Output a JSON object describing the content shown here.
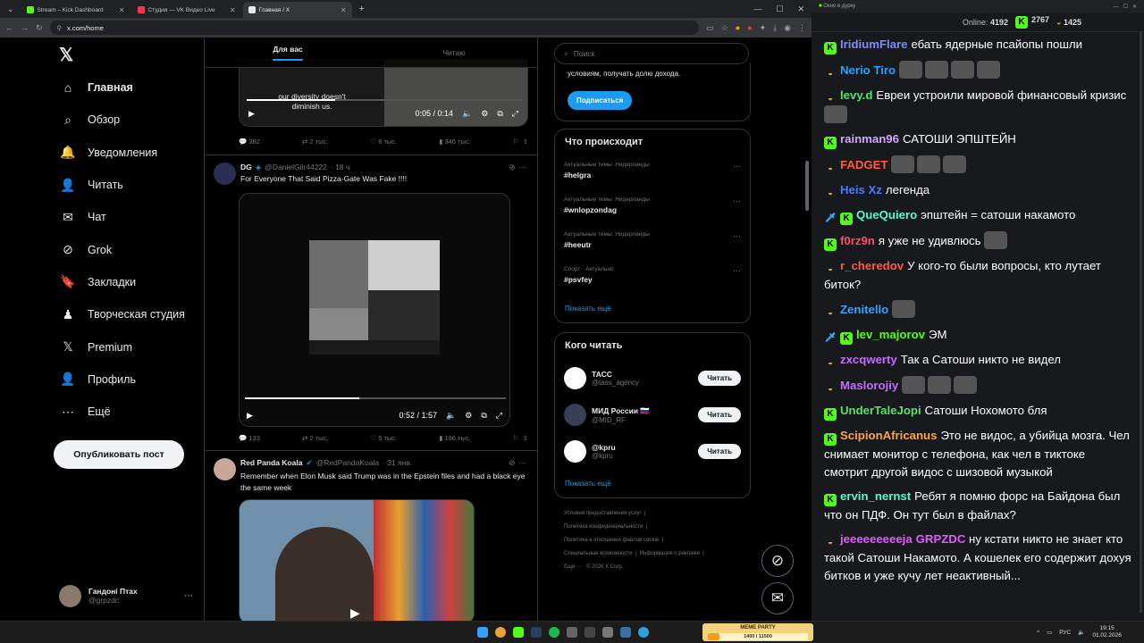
{
  "browser": {
    "tabs": [
      {
        "title": "Stream – Kick Dashboard",
        "color": "#53fc18"
      },
      {
        "title": "Студия — VK Видео Live",
        "color": "#ff3347"
      },
      {
        "title": "Главная / X",
        "color": "#e7e9ea"
      }
    ],
    "url": "x.com/home"
  },
  "x": {
    "logo": "𝕏",
    "nav": [
      {
        "label": "Главная",
        "icon": "home-icon",
        "glyph": "⌂"
      },
      {
        "label": "Обзор",
        "icon": "search-icon",
        "glyph": "⌕"
      },
      {
        "label": "Уведомления",
        "icon": "bell-icon",
        "glyph": "🔔"
      },
      {
        "label": "Читать",
        "icon": "follow-icon",
        "glyph": "👤"
      },
      {
        "label": "Чат",
        "icon": "mail-icon",
        "glyph": "✉"
      },
      {
        "label": "Grok",
        "icon": "grok-icon",
        "glyph": "⊘"
      },
      {
        "label": "Закладки",
        "icon": "bookmark-icon",
        "glyph": "🔖"
      },
      {
        "label": "Творческая студия",
        "icon": "studio-icon",
        "glyph": "♟"
      },
      {
        "label": "Premium",
        "icon": "premium-icon",
        "glyph": "𝕏"
      },
      {
        "label": "Профиль",
        "icon": "profile-icon",
        "glyph": "👤"
      },
      {
        "label": "Ещё",
        "icon": "more-icon",
        "glyph": "⋯"
      }
    ],
    "post_button": "Опубликовать пост",
    "account": {
      "name": "Гандоні Птах",
      "handle": "@grpzdc"
    },
    "feed_tabs": [
      "Для вас",
      "Читаю"
    ],
    "post0": {
      "caption_line1": "our diversity doesn't",
      "caption_line2": "diminish us.",
      "time": "0:05 / 0:14",
      "stats": [
        "382",
        "2 тыс.",
        "6 тыс.",
        "346 тыс."
      ]
    },
    "post1": {
      "name": "DG",
      "handle": "@DanielGilr44222",
      "ago": "· 18 ч",
      "text": "For Everyone That Said Pizza-Gate Was Fake !!!!",
      "time": "0:52 / 1:57",
      "stats": [
        "133",
        "2 тыс.",
        "5 тыс.",
        "196 тыс."
      ]
    },
    "post2": {
      "name": "Red Panda Koala",
      "handle": "@RedPandaKoala",
      "ago": "· 31 янв.",
      "text": "Remember when Elon Musk said Trump was in the Epstein files and had a black eye the same week"
    },
    "search_placeholder": "Поиск",
    "premium": {
      "text": "условиям, получать долю дохода.",
      "button": "Подписаться"
    },
    "trends_title": "Что происходит",
    "trends": [
      {
        "context": "Актуальные темы: Нидерланды",
        "tag": "#helgra"
      },
      {
        "context": "Актуальные темы: Нидерланды",
        "tag": "#wnlopzondag"
      },
      {
        "context": "Актуальные темы: Нидерланды",
        "tag": "#heeutr"
      },
      {
        "context": "Спорт · Актуально",
        "tag": "#psvfey"
      }
    ],
    "show_more": "Показать ещё",
    "who_title": "Кого читать",
    "who": [
      {
        "name": "ТАСС",
        "handle": "@tass_agency",
        "btn": "Читать",
        "color": "#ffffff"
      },
      {
        "name": "МИД России 🇷🇺",
        "handle": "@MID_RF",
        "btn": "Читать",
        "color": "#3a3f55"
      },
      {
        "name": "@kpru",
        "handle": "@kpru",
        "btn": "Читать",
        "color": "#ffffff"
      }
    ],
    "footer": [
      "Условия предоставления услуг",
      "Политика конфиденциальности",
      "Политика в отношении файлов cookie",
      "Специальные возможности",
      "Информация о рекламе",
      "Ещё ···",
      "© 2026 X Corp."
    ]
  },
  "chat": {
    "window_title": "Окно в дурку",
    "online_label": "Online:",
    "online": "4192",
    "kick_count": "2767",
    "other_count": "1425",
    "messages": [
      {
        "badges": [
          "kick"
        ],
        "user": "IridiumFlare",
        "color": "#7b8cff",
        "text": "ебать ядерные псайопы пошли",
        "emotes": 0
      },
      {
        "badges": [
          "sub"
        ],
        "user": "Nerio Tiro",
        "color": "#1fa3ff",
        "text": "",
        "emotes": 4
      },
      {
        "badges": [
          "sub"
        ],
        "user": "levy.d",
        "color": "#58e06a",
        "text": "Евреи устроили мировой финансовый кризис",
        "emotes": 1
      },
      {
        "badges": [
          "kick"
        ],
        "user": "rainman96",
        "color": "#d4a4ff",
        "text": "САТОШИ ЭПШТЕЙН",
        "emotes": 0
      },
      {
        "badges": [
          "sub"
        ],
        "user": "FADGET",
        "color": "#ff5a3c",
        "text": "",
        "emotes": 3
      },
      {
        "badges": [
          "sub"
        ],
        "user": "Heis Xz",
        "color": "#4a7cff",
        "text": "легенда",
        "emotes": 0
      },
      {
        "badges": [
          "sword",
          "kick"
        ],
        "user": "QueQuiero",
        "color": "#53fcc4",
        "text": "эпштейн = сатоши накамото",
        "emotes": 0
      },
      {
        "badges": [
          "kick"
        ],
        "user": "f0rz9n",
        "color": "#ff4d6a",
        "text": "я уже не удивлюсь",
        "emotes": 1
      },
      {
        "badges": [
          "sub"
        ],
        "user": "r_cheredov",
        "color": "#ff5a3c",
        "text": "У кого-то были вопросы, кто лутает биток?",
        "emotes": 0
      },
      {
        "badges": [
          "sub"
        ],
        "user": "Zenitello",
        "color": "#3aa0ff",
        "text": "",
        "emotes": 1
      },
      {
        "badges": [
          "sword",
          "kick"
        ],
        "user": "lev_majorov",
        "color": "#53fc18",
        "text": "ЭМ",
        "emotes": 0
      },
      {
        "badges": [
          "sub"
        ],
        "user": "zxcqwerty",
        "color": "#c46bff",
        "text": "Так а Сатоши никто не видел",
        "emotes": 0
      },
      {
        "badges": [
          "sub"
        ],
        "user": "Maslorojiy",
        "color": "#c46bff",
        "text": "",
        "emotes": 3
      },
      {
        "badges": [
          "kick"
        ],
        "user": "UnderTaleJopi",
        "color": "#58e06a",
        "text": "Сатоши Нохомото бля",
        "emotes": 0
      },
      {
        "badges": [
          "kick"
        ],
        "user": "ScipionAfricanus",
        "color": "#ffa53a",
        "text": "Это не видос, а убийца мозга. Чел снимает монитор с телефона, как чел в тиктоке смотрит другой видос с шизовой музыкой",
        "emotes": 0
      },
      {
        "badges": [
          "kick"
        ],
        "user": "ervin_nernst",
        "color": "#53fcc4",
        "text": "Ребят я помню форс на Байдона был что он ПДФ. Он тут был в файлах?",
        "emotes": 0
      },
      {
        "badges": [
          "sub"
        ],
        "user": "jeeeeeeeeeja",
        "color": "#e05cff",
        "mention": "GRPZDC",
        "text": "ну кстати никто не знает кто такой Сатоши Накамото. А кошелек его содержит дохуя битков и уже кучу лет неактивный...",
        "emotes": 0
      }
    ]
  },
  "taskbar": {
    "widget": "MEME PARTY",
    "widget_progress": "1400 / 11500",
    "lang": "РУС",
    "time": "19:15",
    "date": "01.02.2026"
  }
}
